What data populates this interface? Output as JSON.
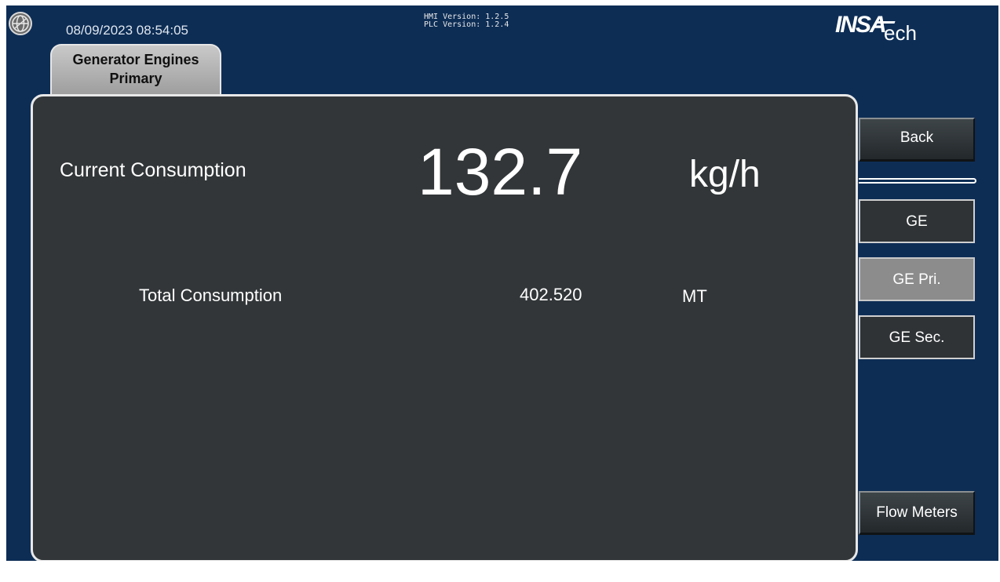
{
  "header": {
    "datetime": "08/09/2023 08:54:05",
    "hmi_version": "HMI Version: 1.2.5",
    "plc_version": "PLC Version: 1.2.4",
    "brand_logo_text": "INSATech",
    "logo_icon": "globe-icon"
  },
  "tab": {
    "line1": "Generator Engines",
    "line2": "Primary"
  },
  "current_consumption": {
    "label": "Current Consumption",
    "value": "132.7",
    "unit": "kg/h"
  },
  "total_consumption": {
    "label": "Total Consumption",
    "value": "402.520",
    "unit": "MT"
  },
  "nav": {
    "back": "Back",
    "ge": "GE",
    "ge_pri": "GE Pri.",
    "ge_sec": "GE Sec.",
    "flow_meters": "Flow Meters",
    "selected": "GE Pri."
  },
  "colors": {
    "background": "#0d2d55",
    "panel": "#323638",
    "selected_button": "#8c8c8c"
  }
}
